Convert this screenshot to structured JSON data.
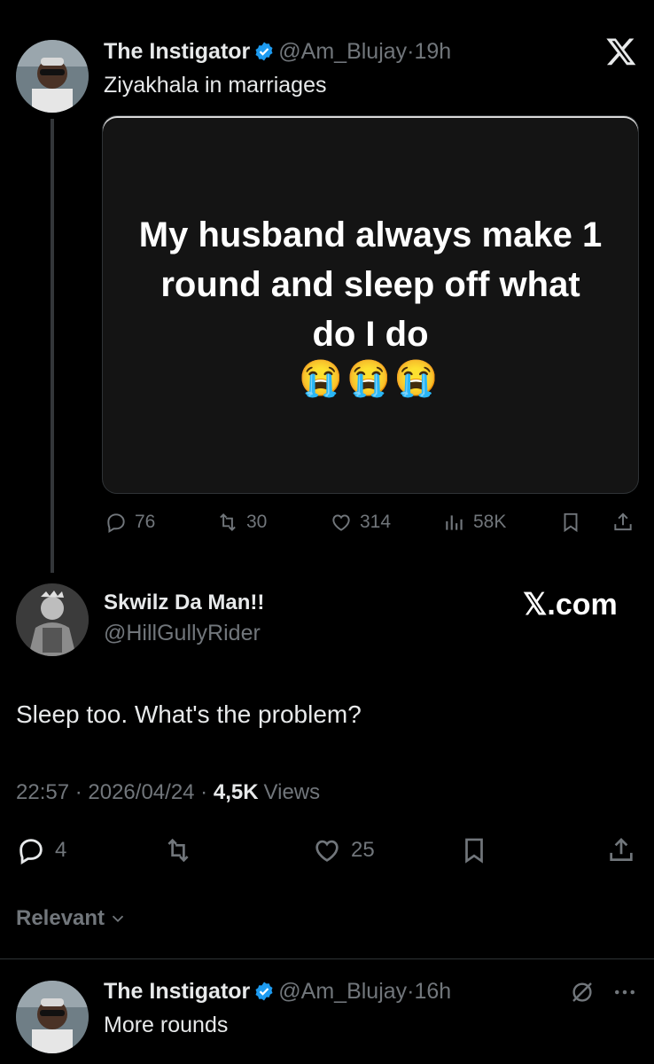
{
  "tweet": {
    "author_name": "The Instigator",
    "author_handle": "@Am_Blujay",
    "time": "19h",
    "text": "Ziyakhala in marriages",
    "media_text": "My husband always make 1 round and sleep off what do I do",
    "media_emoji": "😭😭😭",
    "stats": {
      "replies": "76",
      "reposts": "30",
      "likes": "314",
      "views": "58K"
    }
  },
  "reply": {
    "author_name": "Skwilz Da Man!!",
    "author_handle": "@HillGullyRider",
    "text": "Sleep too. What's the problem?",
    "time": "22:57",
    "date": "2026/04/24",
    "views_count": "4,5K",
    "views_label": "Views",
    "stats": {
      "replies": "4",
      "likes": "25"
    }
  },
  "brand": "𝕏.com",
  "sort_label": "Relevant",
  "next_tweet": {
    "author_name": "The Instigator",
    "author_handle": "@Am_Blujay",
    "time": "16h",
    "text": "More rounds"
  },
  "colors": {
    "background": "#000000",
    "muted": "#71767b",
    "verified": "#1d9bf0"
  },
  "icons": [
    "x-logo-icon",
    "verified-icon",
    "reply-icon",
    "repost-icon",
    "like-icon",
    "views-icon",
    "bookmark-icon",
    "share-icon",
    "chevron-down-icon",
    "grok-icon",
    "more-icon"
  ]
}
